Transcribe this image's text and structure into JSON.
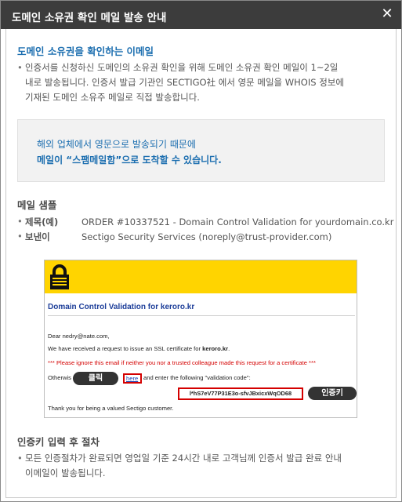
{
  "dialog": {
    "title": "도메인 소유권 확인 메일 발송 안내",
    "close_glyph": "✕"
  },
  "section1": {
    "title": "도메인 소유권을 확인하는 이메일",
    "body_line1": "인증서를 신청하신 도메인의 소유권 확인을 위해 도메인 소유권 확인 메일이 1~2일",
    "body_line2": "내로 발송됩니다. 인증서 발급 기관인 SECTIGO社 에서 영문 메일을 WHOIS 정보에",
    "body_line3": "기재된 도메인 소유주 메일로 직접 발송합니다."
  },
  "notice": {
    "line1": "해외 업체에서 영문으로 발송되기 때문에",
    "line2": "메일이 “스팸메일함”으로 도착할 수 있습니다."
  },
  "sample": {
    "title": "메일 샘플",
    "subject_key": "제목(예)",
    "subject_value": "ORDER #10337521 - Domain Control Validation for yourdomain.co.kr",
    "sender_key": "보낸이",
    "sender_value": "Sectigo Security Services (noreply@trust-provider.com)"
  },
  "email": {
    "title": "Domain Control Validation for keroro.kr",
    "greeting": "Dear nedry@nate.com,",
    "request_pre": "We have received a request to issue an SSL certificate for ",
    "request_domain": "keroro.kr",
    "request_post": ".",
    "warning": "*** Please ignore this email if neither you nor a trusted colleague made this request for a certificate ***",
    "otherwise": "Otherwis",
    "here": "here",
    "enter_text": " and enter the following \"validation code\":",
    "code": "l*hS7eV77P31E3o-sfvJBxicxWqOD68",
    "thanks": "Thank you for being a valued Sectigo customer.",
    "tag_click": "클릭",
    "tag_code": "인증키"
  },
  "section3": {
    "title": "인증키 입력 후 절차",
    "body_line1": "모든 인증절차가 완료되면 영업일 기준 24시간 내로 고객님께 인증서 발급 완료 안내",
    "body_line2": "이메일이 발송됩니다."
  },
  "colors": {
    "titlebar": "#3c3c3c",
    "accent": "#1d6fb0",
    "banner": "#ffd400",
    "highlight": "#d40000"
  }
}
